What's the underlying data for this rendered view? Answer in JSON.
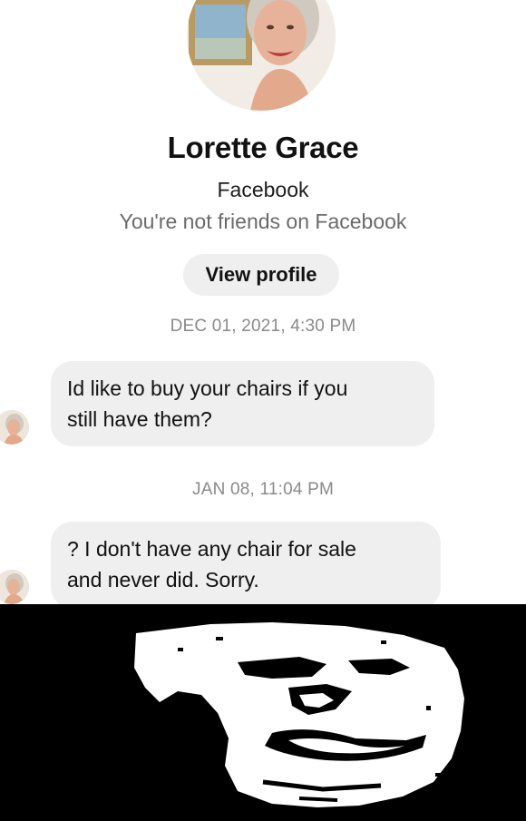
{
  "contact": {
    "name": "Lorette Grace",
    "source": "Facebook",
    "friend_status": "You're not friends on Facebook",
    "view_profile_label": "View profile"
  },
  "messages": [
    {
      "timestamp": "DEC 01, 2021, 4:30 PM",
      "text_line1": "Id like to buy your chairs if you",
      "text_line2": "still have them?"
    },
    {
      "timestamp": "JAN 08, 11:04 PM",
      "text_line1": "? I don't have any chair for sale",
      "text_line2": "and never did. Sorry."
    }
  ],
  "colors": {
    "chat_background": "#ffffff",
    "bubble_background": "#efefef",
    "timestamp_text": "#8a8a8a",
    "meme_background": "#000000",
    "meme_face": "#ffffff"
  },
  "icons": {
    "contact_avatar": "profile-photo",
    "message_avatar": "profile-photo-small",
    "meme_image": "troll-face"
  }
}
